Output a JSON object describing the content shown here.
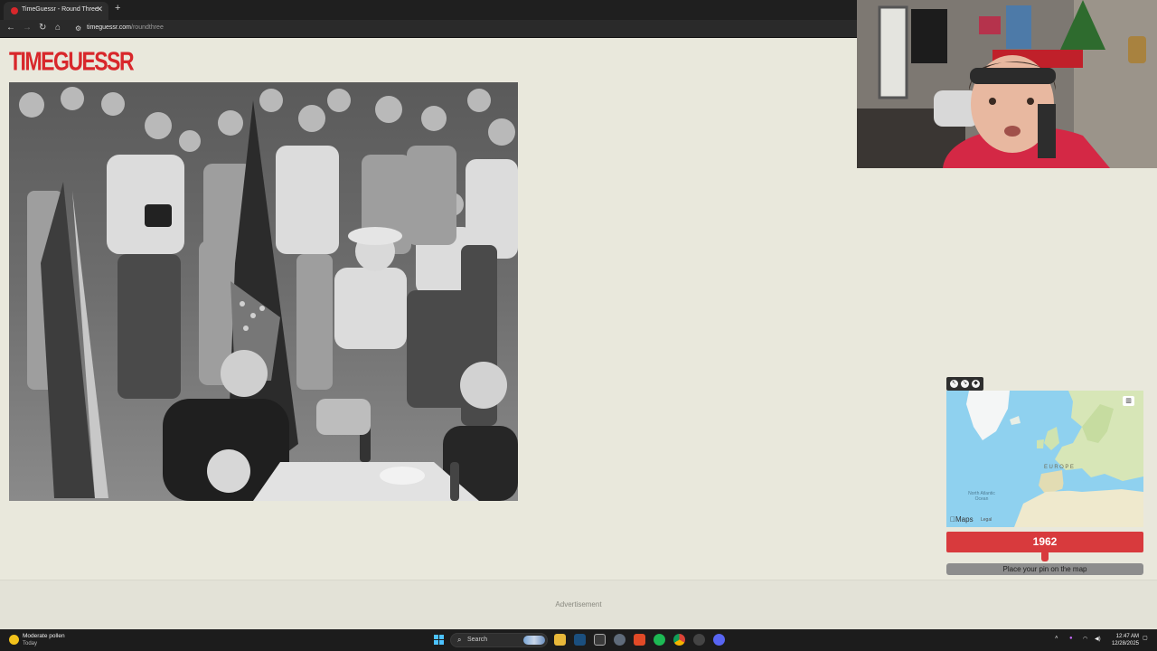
{
  "browser": {
    "tab_title": "TimeGuessr - Round Three",
    "url_host": "timeguessr.com",
    "url_path": "/roundthree"
  },
  "page": {
    "logo": "TIMEGUESSR",
    "ad_label": "Advertisement"
  },
  "map": {
    "brand": "Maps",
    "legal": "Legal",
    "label_continent": "EUROPE",
    "label_ocean": "North Atlantic Ocean"
  },
  "guess": {
    "year": "1962",
    "year_fraction": 0.5,
    "pin_button": "Place your pin on the map"
  },
  "taskbar": {
    "weather_title": "Moderate pollen",
    "weather_sub": "Today",
    "search_label": "Search",
    "time": "12:47 AM",
    "date": "12/28/2025"
  },
  "colors": {
    "brand_red": "#d8272b",
    "page_bg": "#e9e8dc",
    "slider_grey": "#8d8d8d"
  }
}
